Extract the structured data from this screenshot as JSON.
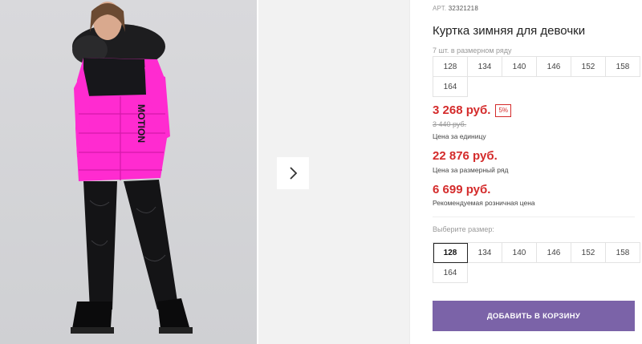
{
  "product": {
    "article_label": "АРТ.",
    "article_number": "32321218",
    "title": "Куртка зимняя для девочки",
    "sizes_in_row_note": "7 шт. в размерном ряду",
    "size_row": [
      "128",
      "134",
      "140",
      "146",
      "152",
      "158",
      "164"
    ],
    "price": "3 268 руб.",
    "discount_badge": "5%",
    "old_price": "3 440 руб.",
    "price_unit_label": "Цена за единицу",
    "row_price": "22 876 руб.",
    "row_price_label": "Цена за размерный ряд",
    "retail_price": "6 699 руб.",
    "retail_price_label": "Рекомендуемая розничная цена"
  },
  "size_selector": {
    "label": "Выберите размер:",
    "options": [
      "128",
      "134",
      "140",
      "146",
      "152",
      "158",
      "164"
    ],
    "selected": "128"
  },
  "cart": {
    "add_label": "ДОБАВИТЬ В КОРЗИНУ"
  },
  "gallery": {
    "next_icon": "chevron-right-icon",
    "jacket_print": "MOTION"
  },
  "colors": {
    "price_red": "#d42b2b",
    "button_purple": "#7b63a8",
    "jacket_pink": "#ff2bd0"
  }
}
